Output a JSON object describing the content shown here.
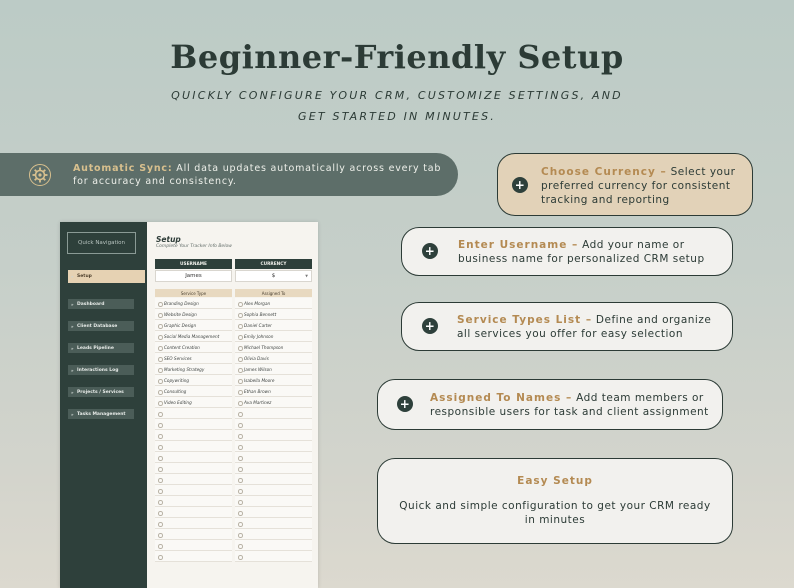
{
  "header": {
    "title": "Beginner-Friendly Setup",
    "subtitle": "Quickly configure your CRM, customize settings, and get started in minutes."
  },
  "banner": {
    "label": "Automatic Sync:",
    "text": " All data updates automatically across every tab for accuracy and consistency.",
    "icon": "gear-sync-icon"
  },
  "sheet": {
    "quick_nav": "Quick Navigation",
    "nav_items": [
      "Setup",
      "Dashboard",
      "Client Database",
      "Leads Pipeline",
      "Interactions Log",
      "Projects / Services",
      "Tasks Management"
    ],
    "title": "Setup",
    "subtitle": "Complete Your Tracker Info Below",
    "username_header": "USERNAME",
    "currency_header": "CURRENCY",
    "username_value": "James",
    "currency_value": "$",
    "service_type_header": "Service Type",
    "assigned_to_header": "Assigned To",
    "service_types": [
      "Branding Design",
      "Website Design",
      "Graphic Design",
      "Social Media Management",
      "Content Creation",
      "SEO Services",
      "Marketing Strategy",
      "Copywriting",
      "Consulting",
      "Video Editing"
    ],
    "assigned_to": [
      "Alex Morgan",
      "Sophia Bennett",
      "Daniel Carter",
      "Emily Johnson",
      "Michael Thompson",
      "Olivia Davis",
      "James Wilson",
      "Isabella Moore",
      "Ethan Brown",
      "Ava Martinez"
    ]
  },
  "cards": {
    "currency": {
      "heading": "Choose Currency –",
      "text": " Select your preferred currency for consistent tracking and reporting"
    },
    "username": {
      "heading": "Enter Username –",
      "text": " Add your name or business name for personalized CRM setup"
    },
    "services": {
      "heading": "Service Types List –",
      "text": " Define and organize all services you offer for easy selection"
    },
    "assigned": {
      "heading": "Assigned To Names –",
      "text": " Add team members or responsible users for task and client assignment"
    },
    "easy": {
      "heading": "Easy Setup",
      "text": "Quick and simple configuration to get your CRM ready in minutes"
    }
  },
  "colors": {
    "dark_green": "#2e403b",
    "accent_gold": "#b48a52",
    "tan_card": "#e2d2b8"
  }
}
